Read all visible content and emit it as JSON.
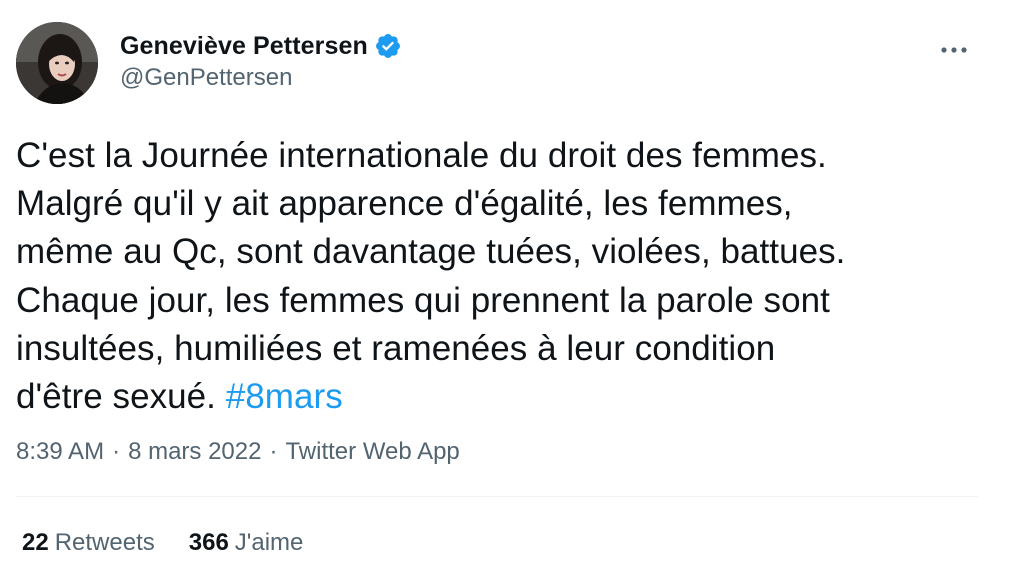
{
  "author": {
    "name": "Geneviève Pettersen",
    "handle": "@GenPettersen",
    "verified": true,
    "avatar_icon": "profile-photo"
  },
  "tweet": {
    "text": "C'est la Journée internationale du droit des femmes.\nMalgré qu'il y ait apparence d'égalité, les femmes,\nmême au Qc, sont davantage tuées, violées, battues.\nChaque jour, les femmes qui prennent la parole sont\ninsultées, humiliées et ramenées à leur condition\nd'être sexué. ",
    "hashtag": "#8mars"
  },
  "meta": {
    "time": "8:39 AM",
    "separator": "·",
    "date": "8 mars 2022",
    "source": "Twitter Web App"
  },
  "stats": {
    "retweets_count": "22",
    "retweets_label": "Retweets",
    "likes_count": "366",
    "likes_label": "J'aime"
  },
  "icons": {
    "verified": "verified-badge-icon",
    "more": "more-options-icon"
  },
  "colors": {
    "text": "#0f1419",
    "secondary": "#536471",
    "accent": "#1d9bf0",
    "divider": "#eff3f4"
  }
}
